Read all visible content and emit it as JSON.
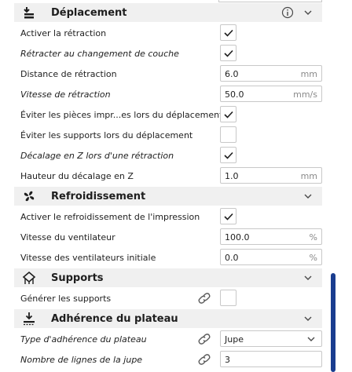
{
  "sections": {
    "travel": {
      "title": "Déplacement",
      "icon": "travel-icon"
    },
    "cooling": {
      "title": "Refroidissement",
      "icon": "fan-icon"
    },
    "support": {
      "title": "Supports",
      "icon": "support-icon"
    },
    "adhesion": {
      "title": "Adhérence du plateau",
      "icon": "adhesion-icon"
    }
  },
  "travel": {
    "retraction_enable": {
      "label": "Activer la rétraction",
      "checked": true
    },
    "retract_layer_change": {
      "label": "Rétracter au changement de couche",
      "checked": true
    },
    "retraction_distance": {
      "label": "Distance de rétraction",
      "value": "6.0",
      "unit": "mm"
    },
    "retraction_speed": {
      "label": "Vitesse de rétraction",
      "value": "50.0",
      "unit": "mm/s"
    },
    "avoid_printed": {
      "label": "Éviter les pièces impr...es lors du déplacement",
      "checked": true
    },
    "avoid_supports": {
      "label": "Éviter les supports lors du déplacement",
      "checked": false
    },
    "hop_enabled": {
      "label": "Décalage en Z lors d'une rétraction",
      "checked": true
    },
    "hop_height": {
      "label": "Hauteur du décalage en Z",
      "value": "1.0",
      "unit": "mm"
    }
  },
  "cooling": {
    "fan_enabled": {
      "label": "Activer le refroidissement de l'impression",
      "checked": true
    },
    "fan_speed": {
      "label": "Vitesse du ventilateur",
      "value": "100.0",
      "unit": "%"
    },
    "fan_speed_initial": {
      "label": "Vitesse des ventilateurs initiale",
      "value": "0.0",
      "unit": "%"
    }
  },
  "support": {
    "support_enable": {
      "label": "Générer les supports",
      "checked": false
    }
  },
  "adhesion": {
    "adhesion_type": {
      "label": "Type d'adhérence du plateau",
      "value": "Jupe"
    },
    "skirt_line_count": {
      "label": "Nombre de lignes de la jupe",
      "value": "3"
    }
  },
  "colors": {
    "header_bg": "#f0f0f0",
    "scrollbar": "#1a3d8f",
    "border": "#c8c8c8"
  }
}
